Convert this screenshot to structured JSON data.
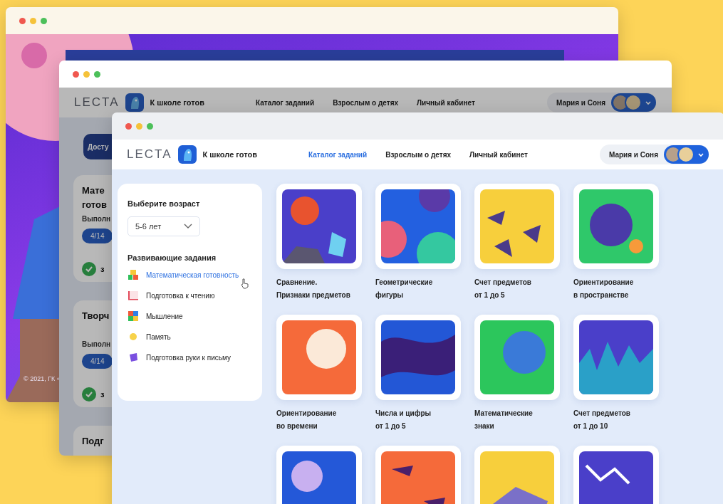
{
  "back_window": {
    "footer": "© 2021, ГК «"
  },
  "middle_window": {
    "header": {
      "logo": "LECTA",
      "app_name": "К школе готов",
      "nav": [
        {
          "label": "Каталог заданий",
          "selected": false
        },
        {
          "label": "Взрослым о детях",
          "selected": false
        },
        {
          "label": "Личный кабинет",
          "selected": false
        }
      ],
      "user": "Мария и Соня"
    },
    "button": "Досту",
    "cards": [
      {
        "title": [
          "Мате",
          "готов"
        ],
        "caption": "Выполн",
        "badge": "4/14",
        "status": "з"
      },
      {
        "title": [
          "Творч"
        ],
        "caption": "Выполн",
        "badge": "4/14",
        "status": "з"
      },
      {
        "title": [
          "Подг"
        ]
      }
    ]
  },
  "front_window": {
    "header": {
      "logo": "LECTA",
      "app_name": "К школе готов",
      "nav": [
        {
          "label": "Каталог заданий",
          "selected": true
        },
        {
          "label": "Взрослым о детях",
          "selected": false
        },
        {
          "label": "Личный кабинет",
          "selected": false
        }
      ],
      "user": "Мария и Соня"
    },
    "sidebar": {
      "age_label": "Выберите возраст",
      "age_select": "5-6 лет",
      "section_title": "Развивающие задания",
      "items": [
        {
          "label": "Математическая готовность",
          "selected": true
        },
        {
          "label": "Подготовка к чтению",
          "selected": false
        },
        {
          "label": "Мышление",
          "selected": false
        },
        {
          "label": "Память",
          "selected": false
        },
        {
          "label": "Подготовка руки к письму",
          "selected": false
        }
      ]
    },
    "tasks": [
      {
        "title": [
          "Сравнение.",
          "Признаки предметов"
        ],
        "color": "#4a3fc9"
      },
      {
        "title": [
          "Геометрические",
          "фигуры"
        ],
        "color": "#2360e0"
      },
      {
        "title": [
          "Счет предметов",
          "от 1 до 5"
        ],
        "color": "#f7cf3c"
      },
      {
        "title": [
          "Ориентирование",
          "в пространстве"
        ],
        "color": "#2fc86a"
      },
      {
        "title": [
          "Ориентирование",
          "во времени"
        ],
        "color": "#f56a3a"
      },
      {
        "title": [
          "Числа и цифры",
          "от 1 до 5"
        ],
        "color": "#2357d6"
      },
      {
        "title": [
          "Математические",
          "знаки"
        ],
        "color": "#2cc65c"
      },
      {
        "title": [
          "Счет предметов",
          "от 1 до 10"
        ],
        "color": "#4a3fc9"
      },
      {
        "color": "#2458d8"
      },
      {
        "color": "#f56a3a"
      },
      {
        "color": "#f7cf3c"
      },
      {
        "color": "#4a3fc9"
      }
    ]
  }
}
